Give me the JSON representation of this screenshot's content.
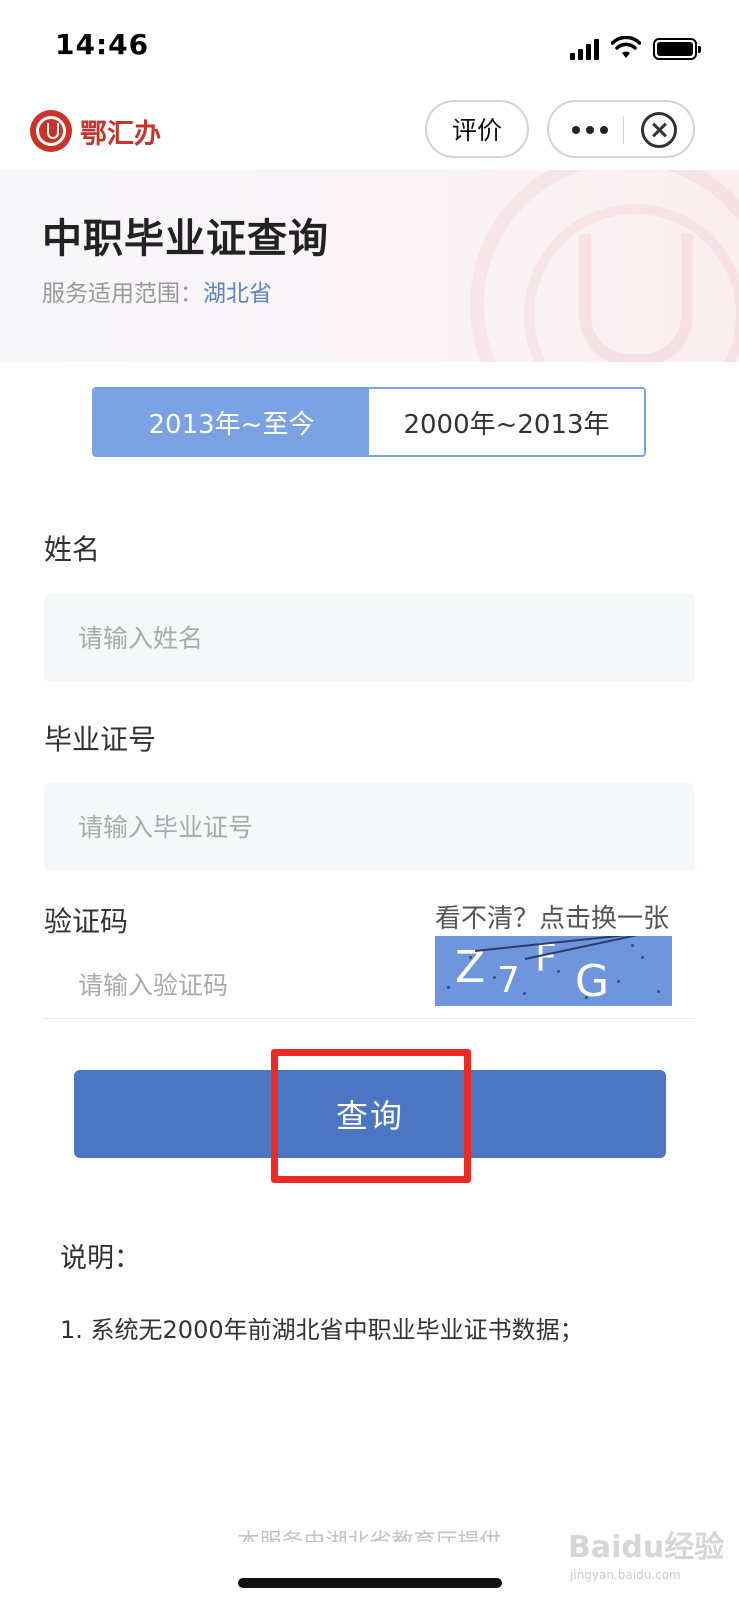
{
  "status_bar": {
    "time": "14:46"
  },
  "nav": {
    "app_name": "鄂汇办",
    "rate_label": "评价"
  },
  "header": {
    "title": "中职毕业证查询",
    "scope_label": "服务适用范围：",
    "scope_value": "湖北省"
  },
  "tabs": [
    {
      "label": "2013年~至今",
      "active": true
    },
    {
      "label": "2000年~2013年",
      "active": false
    }
  ],
  "form": {
    "name_label": "姓名",
    "name_placeholder": "请输入姓名",
    "cert_label": "毕业证号",
    "cert_placeholder": "请输入毕业证号",
    "captcha_label": "验证码",
    "captcha_refresh": "看不清？点击换一张",
    "captcha_placeholder": "请输入验证码",
    "captcha_chars": [
      "Z",
      "7",
      "F",
      "G"
    ]
  },
  "query_button": "查询",
  "notes": {
    "title": "说明：",
    "items": [
      "1. 系统无2000年前湖北省中职业毕业证书数据；"
    ]
  },
  "footer": "本服务由湖北省教育厅提供",
  "watermark": {
    "text": "Baidu经验",
    "sub": "jingyan.baidu.com"
  },
  "colors": {
    "primary": "#4c76c3",
    "tab_active": "#7ba3e3",
    "brand_red": "#c8332a",
    "highlight": "#ee2a24",
    "scope_link": "#5b84c7"
  }
}
